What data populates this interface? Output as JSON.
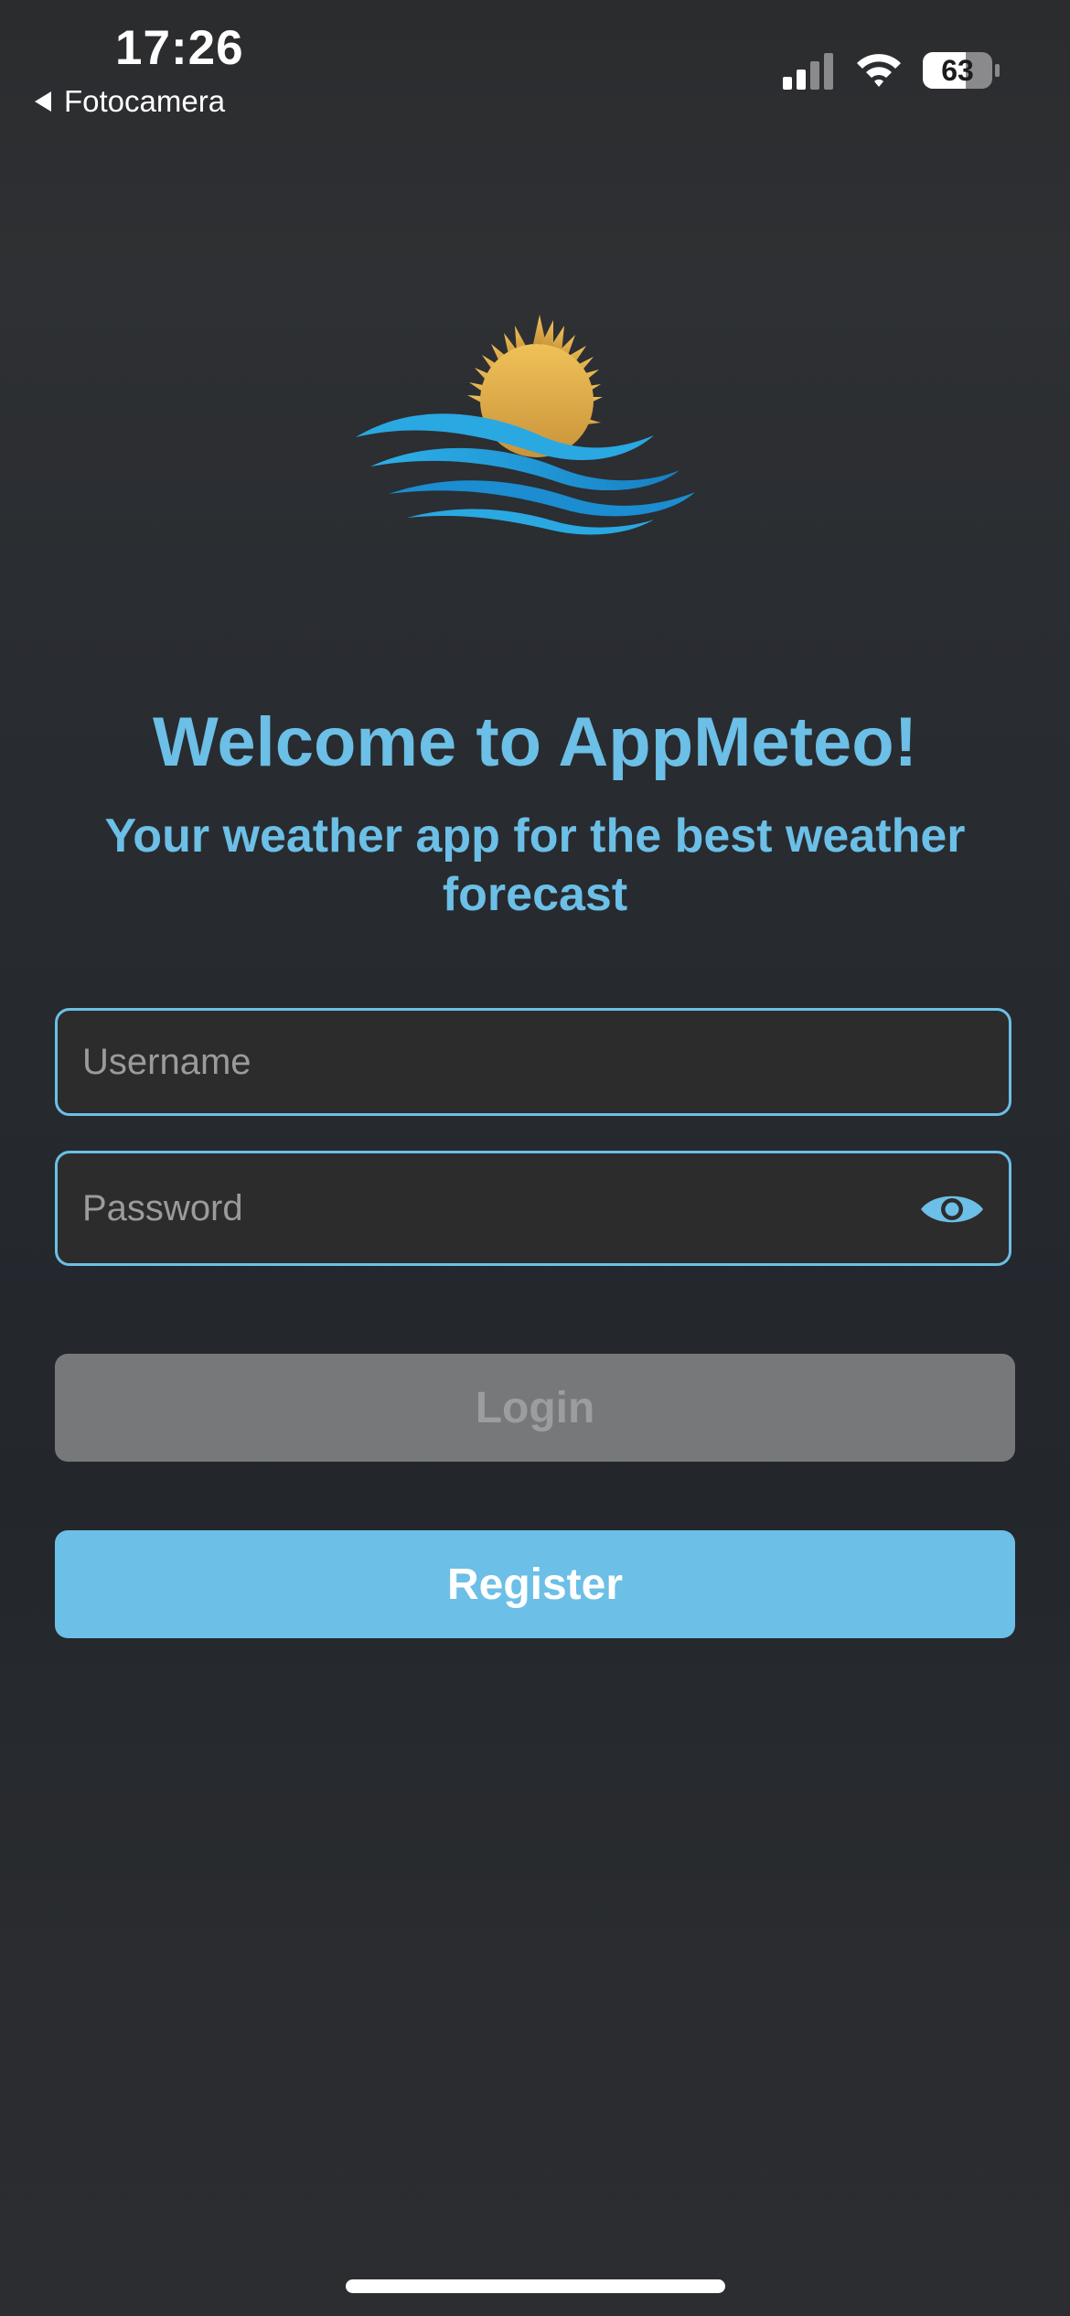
{
  "status_bar": {
    "time": "17:26",
    "back_app": "Fotocamera",
    "battery_percent": "63",
    "signal_bars_filled": 2,
    "signal_bars_total": 4
  },
  "app": {
    "title": "Welcome to AppMeteo!",
    "subtitle": "Your weather app for the best weather forecast",
    "logo_icon": "sun-over-waves-logo"
  },
  "form": {
    "username_placeholder": "Username",
    "password_placeholder": "Password",
    "show_password_icon": "eye-icon"
  },
  "buttons": {
    "login_label": "Login",
    "login_enabled": false,
    "register_label": "Register"
  },
  "colors": {
    "accent": "#6cbfe6",
    "disabled_button": "#777879",
    "sun": "#e0ab44",
    "wave_light": "#29a6e0",
    "wave_dark": "#1680c4"
  }
}
